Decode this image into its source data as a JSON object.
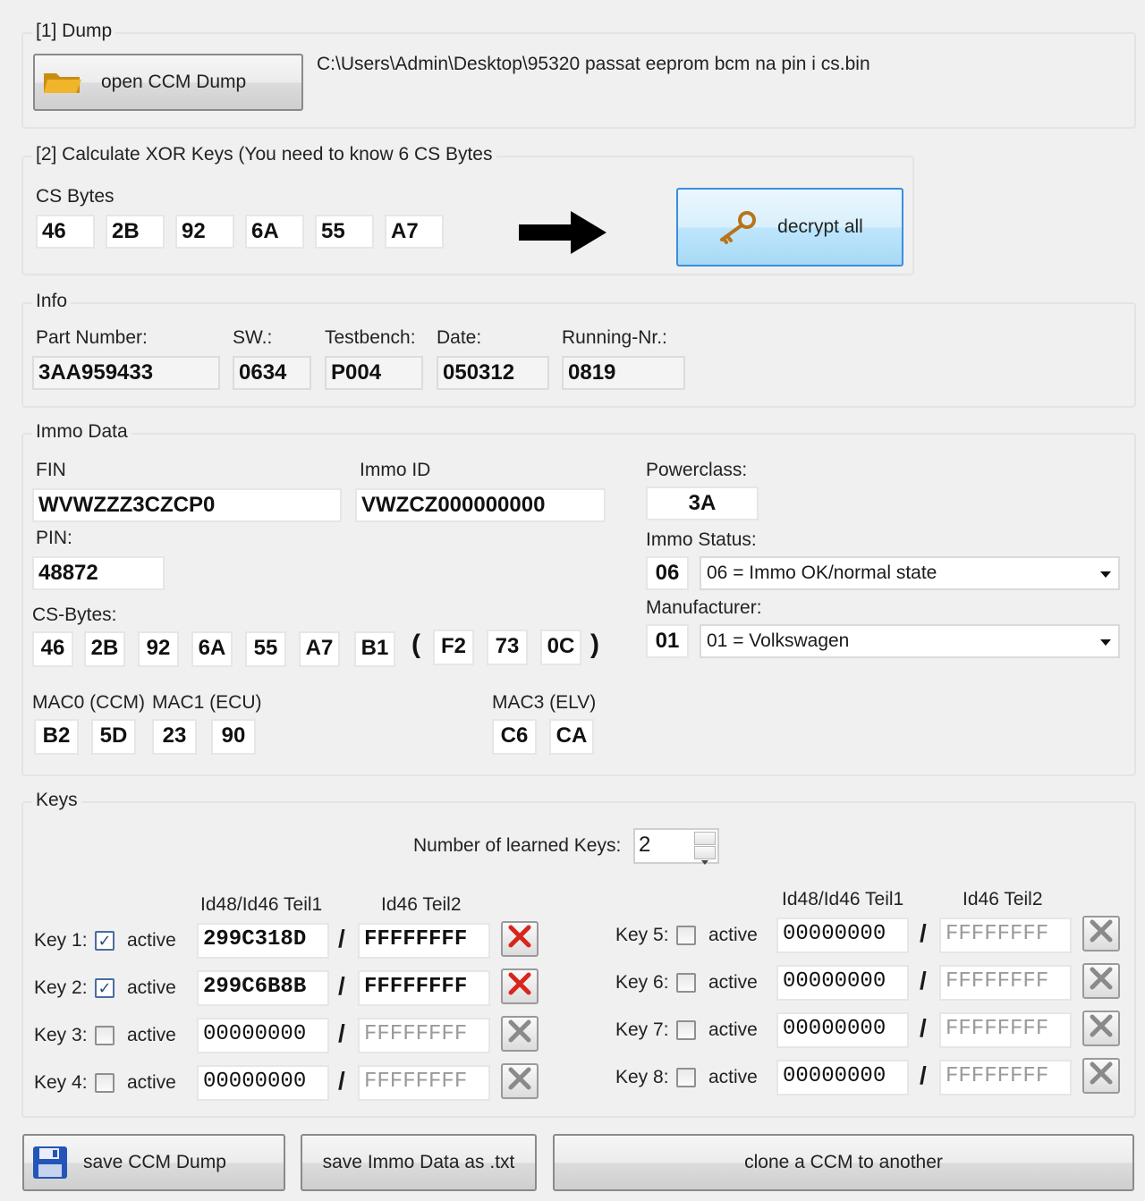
{
  "dump": {
    "legend": "[1] Dump",
    "open_button": "open CCM Dump",
    "path": "C:\\Users\\Admin\\Desktop\\95320 passat eeprom bcm na pin i cs.bin"
  },
  "xor": {
    "legend": "[2] Calculate XOR Keys (You need to know 6 CS Bytes",
    "cs_label": "CS Bytes",
    "cs_bytes": [
      "46",
      "2B",
      "92",
      "6A",
      "55",
      "A7"
    ],
    "decrypt_button": "decrypt all"
  },
  "info": {
    "legend": "Info",
    "part_number_label": "Part Number:",
    "part_number": "3AA959433",
    "sw_label": "SW.:",
    "sw": "0634",
    "testbench_label": "Testbench:",
    "testbench": "P004",
    "date_label": "Date:",
    "date": "050312",
    "running_label": "Running-Nr.:",
    "running": "0819"
  },
  "immo": {
    "legend": "Immo Data",
    "fin_label": "FIN",
    "fin": "WVWZZZ3CZCP0",
    "immo_id_label": "Immo ID",
    "immo_id": "VWZCZ000000000",
    "powerclass_label": "Powerclass:",
    "powerclass": "3A",
    "pin_label": "PIN:",
    "pin": "48872",
    "status_label": "Immo Status:",
    "status_code": "06",
    "status_value": "06 = Immo OK/normal state",
    "manufacturer_label": "Manufacturer:",
    "manufacturer_code": "01",
    "manufacturer_value": "01 = Volkswagen",
    "cs_bytes_label": "CS-Bytes:",
    "cs_bytes": [
      "46",
      "2B",
      "92",
      "6A",
      "55",
      "A7",
      "B1"
    ],
    "cs_bytes_extra": [
      "F2",
      "73",
      "0C"
    ],
    "paren_open": "(",
    "paren_close": ")",
    "mac0_label": "MAC0 (CCM)",
    "mac0": [
      "B2",
      "5D"
    ],
    "mac1_label": "MAC1 (ECU)",
    "mac1": [
      "23",
      "90"
    ],
    "mac3_label": "MAC3 (ELV)",
    "mac3": [
      "C6",
      "CA"
    ]
  },
  "keys": {
    "legend": "Keys",
    "learned_label": "Number of learned Keys:",
    "learned_count": "2",
    "col1_header": "Id48/Id46 Teil1",
    "col2_header": "Id46 Teil2",
    "active_label": "active",
    "slash": "/",
    "rows": [
      {
        "label": "Key 1:",
        "active": true,
        "part1": "299C318D",
        "part2": "FFFFFFFF"
      },
      {
        "label": "Key 2:",
        "active": true,
        "part1": "299C6B8B",
        "part2": "FFFFFFFF"
      },
      {
        "label": "Key 3:",
        "active": false,
        "part1": "00000000",
        "part2": "FFFFFFFF"
      },
      {
        "label": "Key 4:",
        "active": false,
        "part1": "00000000",
        "part2": "FFFFFFFF"
      },
      {
        "label": "Key 5:",
        "active": false,
        "part1": "00000000",
        "part2": "FFFFFFFF"
      },
      {
        "label": "Key 6:",
        "active": false,
        "part1": "00000000",
        "part2": "FFFFFFFF"
      },
      {
        "label": "Key 7:",
        "active": false,
        "part1": "00000000",
        "part2": "FFFFFFFF"
      },
      {
        "label": "Key 8:",
        "active": false,
        "part1": "00000000",
        "part2": "FFFFFFFF"
      }
    ]
  },
  "actions": {
    "save_dump": "save CCM Dump",
    "save_txt": "save Immo Data as .txt",
    "clone": "clone a CCM to another"
  },
  "colors": {
    "x_active": "#d8261c",
    "x_inactive": "#8a8a8a"
  }
}
